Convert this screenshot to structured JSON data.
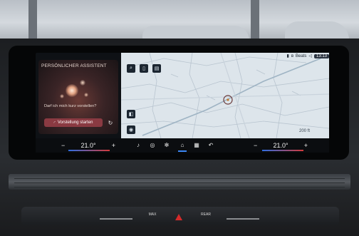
{
  "assistant": {
    "title": "PERSÖNLICHER ASSISTENT",
    "prompt": "Darf ich mich kurz vorstellen?",
    "start_label": "Vorstellung starten",
    "start_icon": "speech-icon",
    "refresh_icon": "refresh-icon"
  },
  "status_bar": {
    "profile": "Beats",
    "time": "13:13"
  },
  "map": {
    "scale": "200 ft"
  },
  "climate": {
    "left_temp": "21.0°",
    "right_temp": "21.0°",
    "minus": "−",
    "plus": "+"
  },
  "controls": {
    "max_label": "MAX",
    "rear_label": "REAR"
  },
  "colors": {
    "accent_red": "#8a3a42",
    "accent_blue": "#3b86f2",
    "hazard": "#d42a2a"
  }
}
